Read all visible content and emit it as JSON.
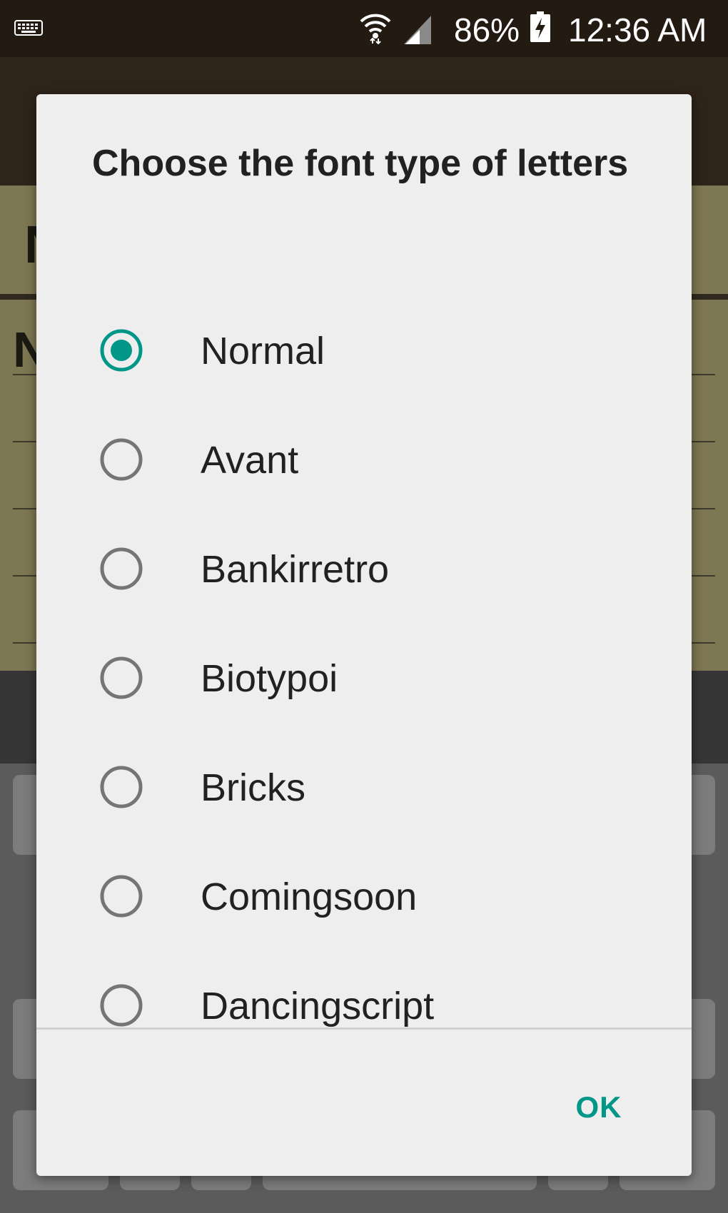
{
  "status_bar": {
    "battery_percent": "86%",
    "time": "12:36 AM",
    "keyboard_icon": "keyboard-icon",
    "wifi_icon": "wifi-icon",
    "signal_icon": "cell-signal-icon",
    "battery_icon": "battery-charging-icon"
  },
  "dialog": {
    "title": "Choose the font type of letters",
    "selected_index": 0,
    "options": [
      {
        "label": "Normal",
        "selected": true
      },
      {
        "label": "Avant",
        "selected": false
      },
      {
        "label": "Bankirretro",
        "selected": false
      },
      {
        "label": "Biotypoi",
        "selected": false
      },
      {
        "label": "Bricks",
        "selected": false
      },
      {
        "label": "Comingsoon",
        "selected": false
      },
      {
        "label": "Dancingscript",
        "selected": false
      }
    ],
    "ok_label": "OK"
  },
  "colors": {
    "accent": "#009688",
    "radio_unselected": "#757575",
    "dialog_background": "#eeeeee",
    "status_bar": "#231a12"
  }
}
